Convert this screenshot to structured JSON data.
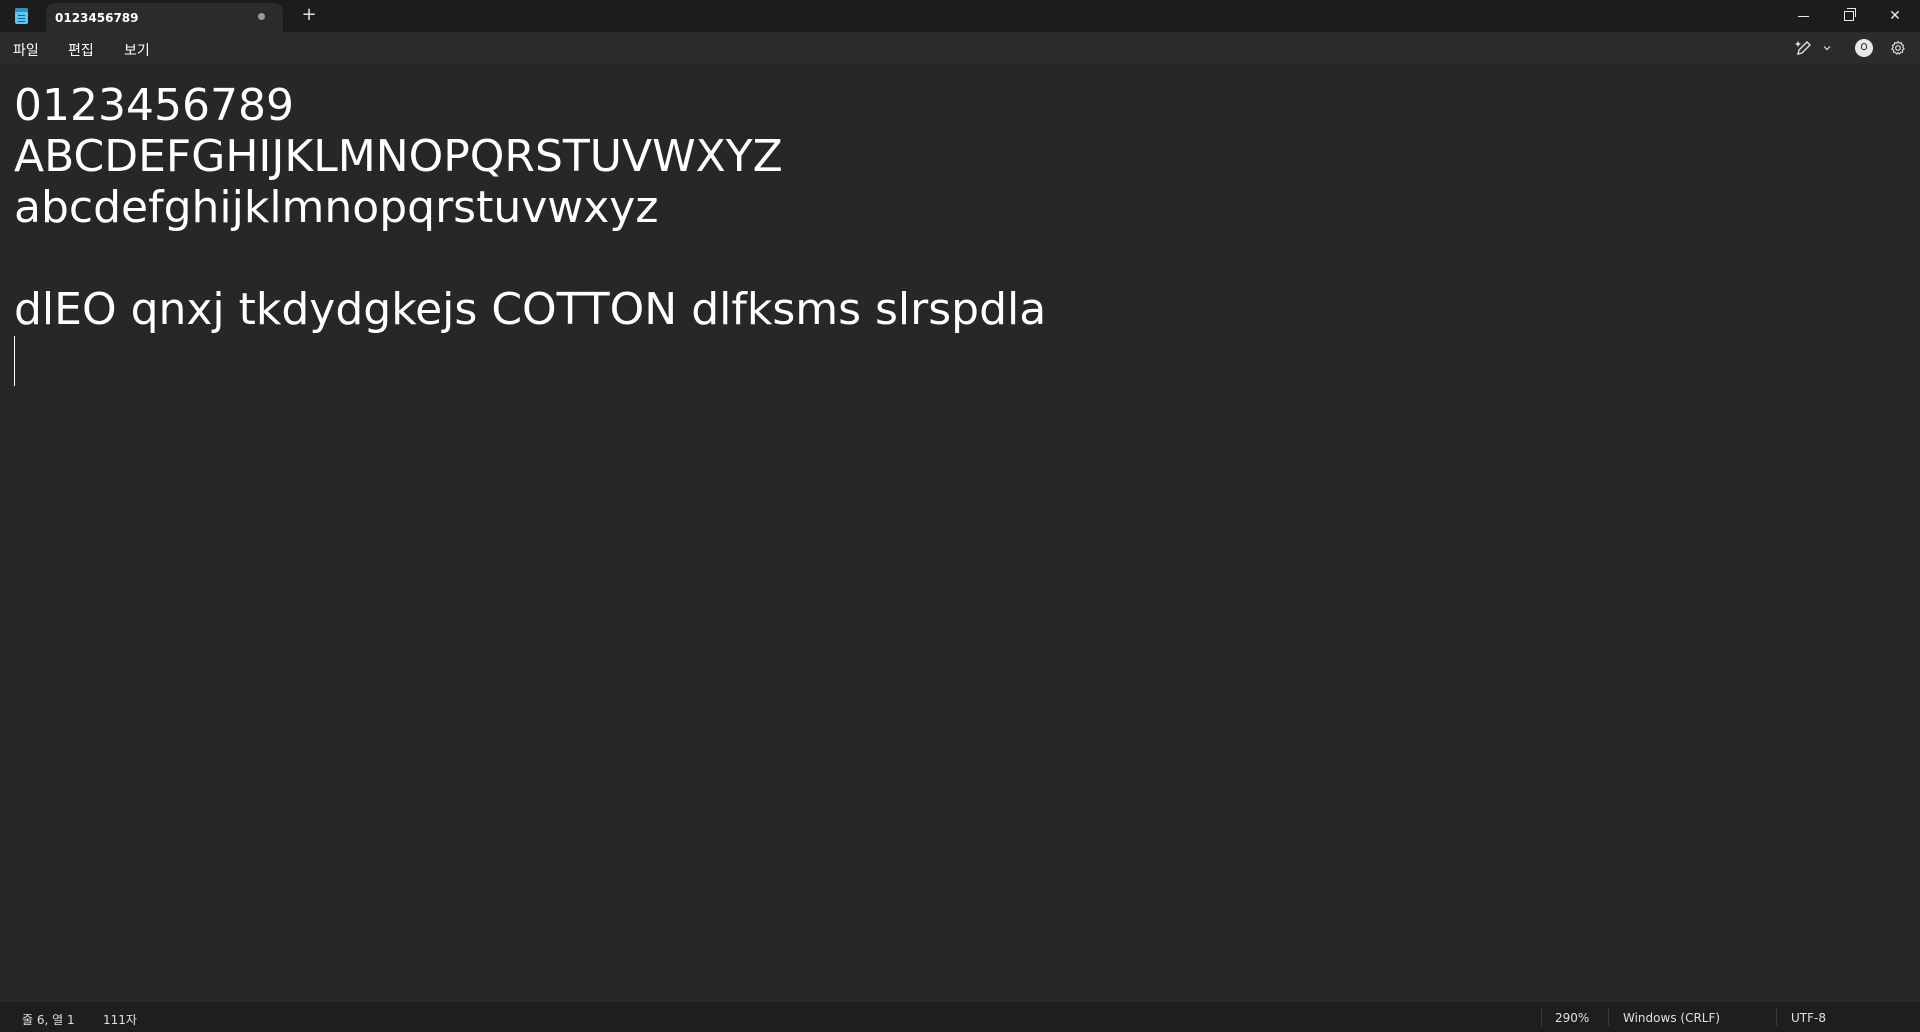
{
  "titlebar": {
    "app_icon": "notepad-icon",
    "tab_title": "0123456789",
    "new_tab_label": "+",
    "minimize_icon": "minimize-icon",
    "restore_icon": "restore-icon",
    "close_label": "✕"
  },
  "menu": {
    "file": "파일",
    "edit": "편집",
    "view": "보기",
    "right_icons": [
      "copilot-pen-icon",
      "chevron-down-icon",
      "account-icon",
      "settings-icon"
    ]
  },
  "editor": {
    "lines": [
      "0123456789",
      "ABCDEFGHIJKLMNOPQRSTUVWXYZ",
      "abcdefghijklmnopqrstuvwxyz",
      "",
      "dlEO qnxj tkdydgkejs COTTON dlfksms slrspdla",
      ""
    ]
  },
  "status": {
    "position": "줄 6, 열 1",
    "char_count": "111자",
    "zoom": "290%",
    "line_ending": "Windows (CRLF)",
    "encoding": "UTF-8"
  },
  "colors": {
    "titlebar_bg": "#1c1c1c",
    "menubar_bg": "#2b2b2b",
    "editor_bg": "#272727",
    "statusbar_bg": "#1e1e1e",
    "text": "#ffffff"
  }
}
